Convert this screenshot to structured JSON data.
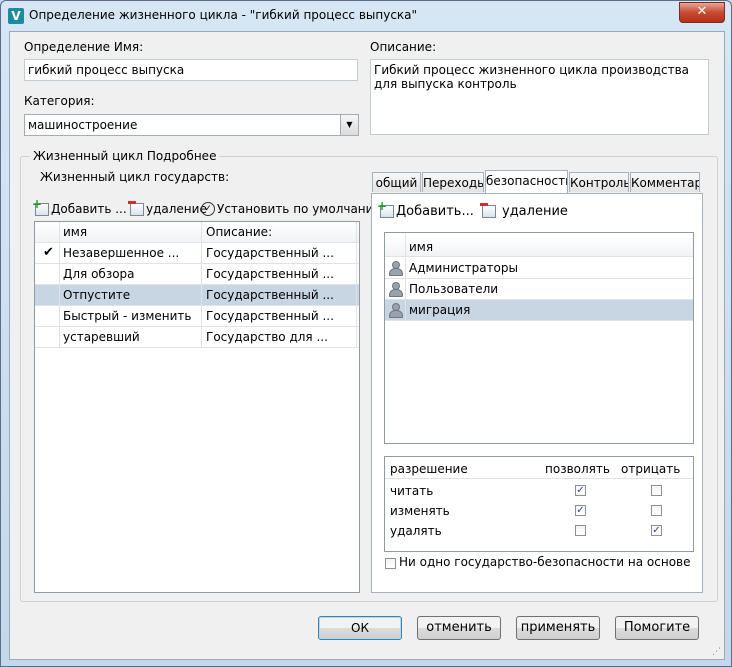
{
  "window": {
    "title": "Определение жизненного цикла - \"гибкий процесс выпуска\"",
    "close_glyph": "✕",
    "app_icon": "V"
  },
  "definition": {
    "name_label": "Определение Имя:",
    "name_value": "гибкий процесс выпуска",
    "category_label": "Категория:",
    "category_value": "машиностроение",
    "description_label": "Описание:",
    "description_value": "Гибкий процесс жизненного цикла производства для выпуска контроль"
  },
  "details": {
    "group_title": "Жизненный цикл Подробнее",
    "states_label": "Жизненный цикл государств:",
    "toolbar": {
      "add_label": "Добавить ...",
      "delete_label": "удаление",
      "set_default_label": "Установить по умолчанию"
    },
    "states_columns": [
      "имя",
      "Описание:"
    ],
    "states": [
      {
        "default_mark": "✔",
        "name": "Незавершенное ...",
        "description": "Государственный ..."
      },
      {
        "default_mark": "",
        "name": "Для обзора",
        "description": "Государственный ..."
      },
      {
        "default_mark": "",
        "name": "Отпустите",
        "description": "Государственный ..."
      },
      {
        "default_mark": "",
        "name": "Быстрый - изменить",
        "description": "Государственный ..."
      },
      {
        "default_mark": "",
        "name": "устаревший",
        "description": "Государство для ..."
      }
    ]
  },
  "tabs": [
    "общий",
    "Переходы",
    "безопасность",
    "Контроль",
    "Комментарии"
  ],
  "security": {
    "add_label": "Добавить...",
    "delete_label": "удаление",
    "members_column": "имя",
    "members": [
      "Администраторы",
      "Пользователи",
      "миграция"
    ],
    "permissions_columns": [
      "разрешение",
      "позволять",
      "отрицать"
    ],
    "permissions": [
      {
        "name": "читать",
        "allow": true,
        "deny": false
      },
      {
        "name": "изменять",
        "allow": true,
        "deny": false
      },
      {
        "name": "удалять",
        "allow": false,
        "deny": true
      }
    ],
    "no_state_security_label": "Ни одно государство-безопасности на основе",
    "no_state_security_checked": false
  },
  "buttons": {
    "ok": "ОК",
    "cancel": "отменить",
    "apply": "применять",
    "help": "Помогите"
  }
}
